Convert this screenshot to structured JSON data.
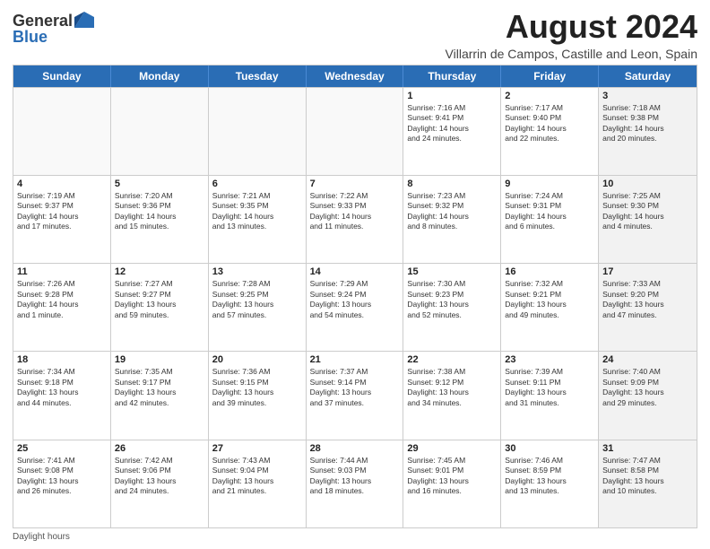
{
  "logo": {
    "general": "General",
    "blue": "Blue"
  },
  "title": "August 2024",
  "subtitle": "Villarrin de Campos, Castille and Leon, Spain",
  "days": [
    "Sunday",
    "Monday",
    "Tuesday",
    "Wednesday",
    "Thursday",
    "Friday",
    "Saturday"
  ],
  "weeks": [
    [
      {
        "day": "",
        "info": "",
        "empty": true
      },
      {
        "day": "",
        "info": "",
        "empty": true
      },
      {
        "day": "",
        "info": "",
        "empty": true
      },
      {
        "day": "",
        "info": "",
        "empty": true
      },
      {
        "day": "1",
        "info": "Sunrise: 7:16 AM\nSunset: 9:41 PM\nDaylight: 14 hours\nand 24 minutes.",
        "empty": false
      },
      {
        "day": "2",
        "info": "Sunrise: 7:17 AM\nSunset: 9:40 PM\nDaylight: 14 hours\nand 22 minutes.",
        "empty": false
      },
      {
        "day": "3",
        "info": "Sunrise: 7:18 AM\nSunset: 9:38 PM\nDaylight: 14 hours\nand 20 minutes.",
        "empty": false,
        "shaded": true
      }
    ],
    [
      {
        "day": "4",
        "info": "Sunrise: 7:19 AM\nSunset: 9:37 PM\nDaylight: 14 hours\nand 17 minutes.",
        "empty": false
      },
      {
        "day": "5",
        "info": "Sunrise: 7:20 AM\nSunset: 9:36 PM\nDaylight: 14 hours\nand 15 minutes.",
        "empty": false
      },
      {
        "day": "6",
        "info": "Sunrise: 7:21 AM\nSunset: 9:35 PM\nDaylight: 14 hours\nand 13 minutes.",
        "empty": false
      },
      {
        "day": "7",
        "info": "Sunrise: 7:22 AM\nSunset: 9:33 PM\nDaylight: 14 hours\nand 11 minutes.",
        "empty": false
      },
      {
        "day": "8",
        "info": "Sunrise: 7:23 AM\nSunset: 9:32 PM\nDaylight: 14 hours\nand 8 minutes.",
        "empty": false
      },
      {
        "day": "9",
        "info": "Sunrise: 7:24 AM\nSunset: 9:31 PM\nDaylight: 14 hours\nand 6 minutes.",
        "empty": false
      },
      {
        "day": "10",
        "info": "Sunrise: 7:25 AM\nSunset: 9:30 PM\nDaylight: 14 hours\nand 4 minutes.",
        "empty": false,
        "shaded": true
      }
    ],
    [
      {
        "day": "11",
        "info": "Sunrise: 7:26 AM\nSunset: 9:28 PM\nDaylight: 14 hours\nand 1 minute.",
        "empty": false
      },
      {
        "day": "12",
        "info": "Sunrise: 7:27 AM\nSunset: 9:27 PM\nDaylight: 13 hours\nand 59 minutes.",
        "empty": false
      },
      {
        "day": "13",
        "info": "Sunrise: 7:28 AM\nSunset: 9:25 PM\nDaylight: 13 hours\nand 57 minutes.",
        "empty": false
      },
      {
        "day": "14",
        "info": "Sunrise: 7:29 AM\nSunset: 9:24 PM\nDaylight: 13 hours\nand 54 minutes.",
        "empty": false
      },
      {
        "day": "15",
        "info": "Sunrise: 7:30 AM\nSunset: 9:23 PM\nDaylight: 13 hours\nand 52 minutes.",
        "empty": false
      },
      {
        "day": "16",
        "info": "Sunrise: 7:32 AM\nSunset: 9:21 PM\nDaylight: 13 hours\nand 49 minutes.",
        "empty": false
      },
      {
        "day": "17",
        "info": "Sunrise: 7:33 AM\nSunset: 9:20 PM\nDaylight: 13 hours\nand 47 minutes.",
        "empty": false,
        "shaded": true
      }
    ],
    [
      {
        "day": "18",
        "info": "Sunrise: 7:34 AM\nSunset: 9:18 PM\nDaylight: 13 hours\nand 44 minutes.",
        "empty": false
      },
      {
        "day": "19",
        "info": "Sunrise: 7:35 AM\nSunset: 9:17 PM\nDaylight: 13 hours\nand 42 minutes.",
        "empty": false
      },
      {
        "day": "20",
        "info": "Sunrise: 7:36 AM\nSunset: 9:15 PM\nDaylight: 13 hours\nand 39 minutes.",
        "empty": false
      },
      {
        "day": "21",
        "info": "Sunrise: 7:37 AM\nSunset: 9:14 PM\nDaylight: 13 hours\nand 37 minutes.",
        "empty": false
      },
      {
        "day": "22",
        "info": "Sunrise: 7:38 AM\nSunset: 9:12 PM\nDaylight: 13 hours\nand 34 minutes.",
        "empty": false
      },
      {
        "day": "23",
        "info": "Sunrise: 7:39 AM\nSunset: 9:11 PM\nDaylight: 13 hours\nand 31 minutes.",
        "empty": false
      },
      {
        "day": "24",
        "info": "Sunrise: 7:40 AM\nSunset: 9:09 PM\nDaylight: 13 hours\nand 29 minutes.",
        "empty": false,
        "shaded": true
      }
    ],
    [
      {
        "day": "25",
        "info": "Sunrise: 7:41 AM\nSunset: 9:08 PM\nDaylight: 13 hours\nand 26 minutes.",
        "empty": false
      },
      {
        "day": "26",
        "info": "Sunrise: 7:42 AM\nSunset: 9:06 PM\nDaylight: 13 hours\nand 24 minutes.",
        "empty": false
      },
      {
        "day": "27",
        "info": "Sunrise: 7:43 AM\nSunset: 9:04 PM\nDaylight: 13 hours\nand 21 minutes.",
        "empty": false
      },
      {
        "day": "28",
        "info": "Sunrise: 7:44 AM\nSunset: 9:03 PM\nDaylight: 13 hours\nand 18 minutes.",
        "empty": false
      },
      {
        "day": "29",
        "info": "Sunrise: 7:45 AM\nSunset: 9:01 PM\nDaylight: 13 hours\nand 16 minutes.",
        "empty": false
      },
      {
        "day": "30",
        "info": "Sunrise: 7:46 AM\nSunset: 8:59 PM\nDaylight: 13 hours\nand 13 minutes.",
        "empty": false
      },
      {
        "day": "31",
        "info": "Sunrise: 7:47 AM\nSunset: 8:58 PM\nDaylight: 13 hours\nand 10 minutes.",
        "empty": false,
        "shaded": true
      }
    ]
  ],
  "footer": "Daylight hours"
}
